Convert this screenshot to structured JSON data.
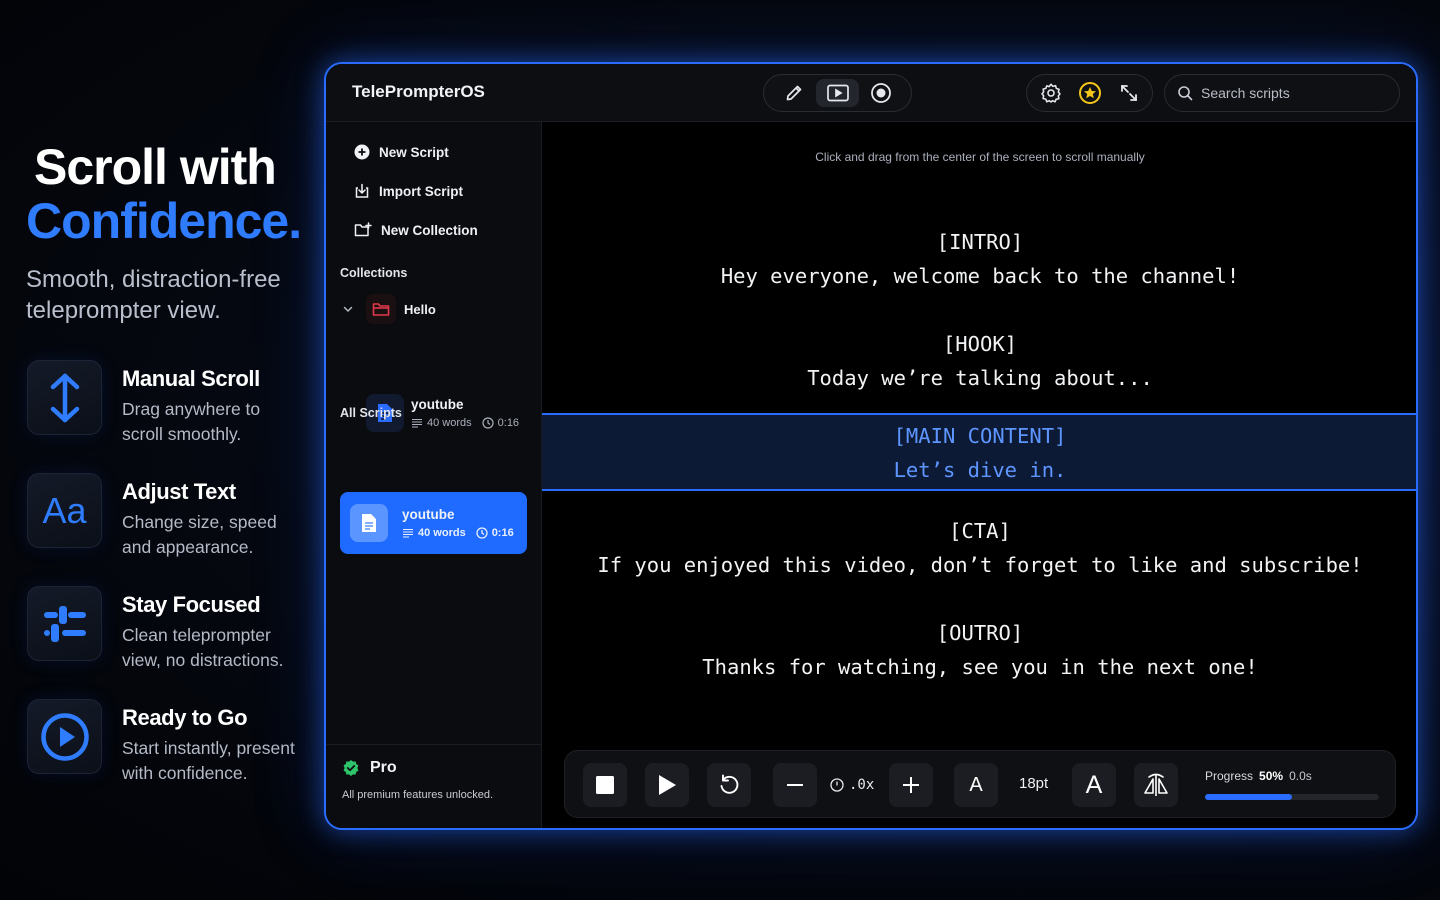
{
  "promo": {
    "headline_line1": "Scroll with",
    "headline_line2": "Confidence.",
    "subtitle": "Smooth, distraction-free teleprompter view.",
    "features": [
      {
        "title": "Manual Scroll",
        "desc": "Drag anywhere to scroll smoothly.",
        "icon": "vertical-arrows-icon"
      },
      {
        "title": "Adjust Text",
        "desc": "Change size, speed and appearance.",
        "icon": "Aa"
      },
      {
        "title": "Stay Focused",
        "desc": "Clean teleprompter view, no distractions.",
        "icon": "sliders-icon"
      },
      {
        "title": "Ready to Go",
        "desc": "Start instantly, present with confidence.",
        "icon": "play-circle-icon"
      }
    ]
  },
  "app": {
    "title": "TelePrompterOS",
    "search_placeholder": "Search scripts",
    "accent": "#2a6cff"
  },
  "sidebar": {
    "actions": [
      "New Script",
      "Import Script",
      "New Collection"
    ],
    "collections_label": "Collections",
    "collection": {
      "name": "Hello",
      "expanded": true
    },
    "collection_script": {
      "name": "youtube",
      "words": "40 words",
      "duration": "0:16"
    },
    "all_scripts_label": "All Scripts",
    "selected_script": {
      "name": "youtube",
      "words": "40 words",
      "duration": "0:16"
    },
    "pro": {
      "label": "Pro",
      "desc": "All premium features unlocked."
    }
  },
  "prompter": {
    "hint": "Click and drag from the center of the screen to scroll manually",
    "lines_above": [
      "[INTRO]",
      "Hey everyone, welcome back to the channel!",
      "",
      "[HOOK]",
      "Today we’re talking about..."
    ],
    "focus_lines": [
      "[MAIN CONTENT]",
      "Let’s dive in."
    ],
    "lines_below": [
      "[CTA]",
      "If you enjoyed this video, don’t forget to like and subscribe!",
      "",
      "[OUTRO]",
      "Thanks for watching, see you in the next one!"
    ]
  },
  "controls": {
    "speed": ".0x",
    "font_size": "18pt",
    "font_small_label": "A",
    "font_large_label": "A",
    "progress_label": "Progress",
    "progress_percent": "50%",
    "progress_time": "0.0s",
    "progress_value": 0.5
  }
}
